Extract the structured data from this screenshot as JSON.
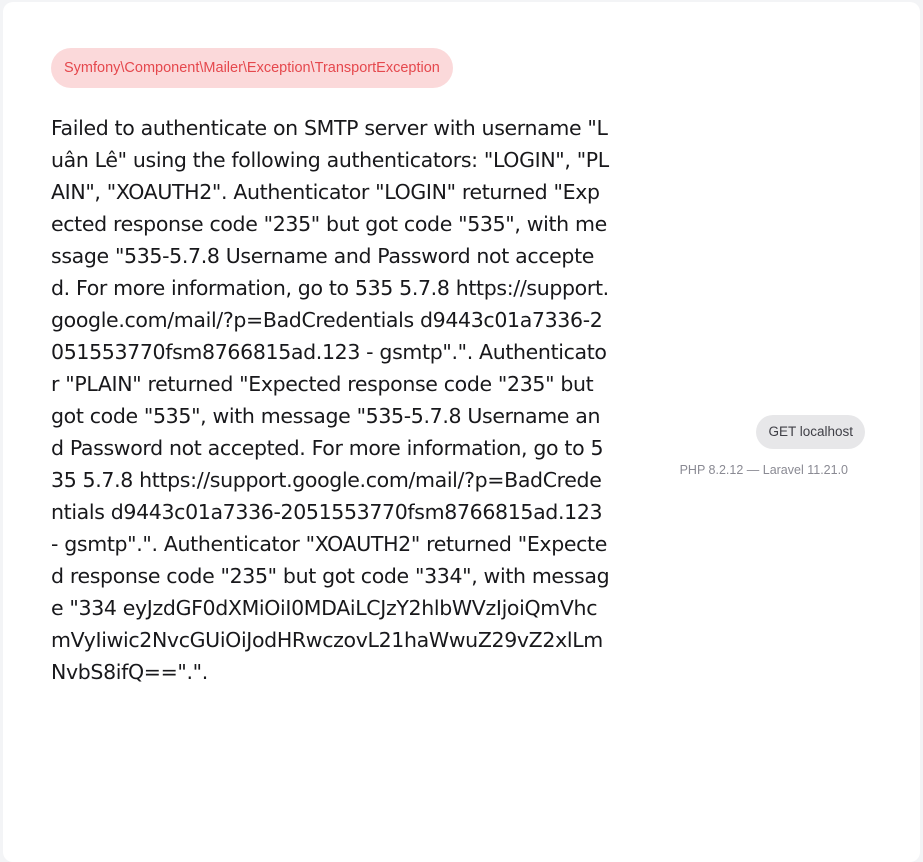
{
  "exception": {
    "class": "Symfony\\Component\\Mailer\\Exception\\TransportException",
    "message": "Failed to authenticate on SMTP server with username \"Luân Lê\" using the following authenticators: \"LOGIN\", \"PLAIN\", \"XOAUTH2\". Authenticator \"LOGIN\" returned \"Expected response code \"235\" but got code \"535\", with message \"535-5.7.8 Username and Password not accepted. For more information, go to 535 5.7.8 https://support.google.com/mail/?p=BadCredentials d9443c01a7336-2051553770fsm8766815ad.123 - gsmtp\".\". Authenticator \"PLAIN\" returned \"Expected response code \"235\" but got code \"535\", with message \"535-5.7.8 Username and Password not accepted. For more information, go to 535 5.7.8 https://support.google.com/mail/?p=BadCredentials d9443c01a7336-2051553770fsm8766815ad.123 - gsmtp\".\". Authenticator \"XOAUTH2\" returned \"Expected response code \"235\" but got code \"334\", with message \"334 eyJzdGF0dXMiOiI0MDAiLCJzY2hlbWVzIjoiQmVhcmVyIiwic2NvcGUiOiJodHRwczovL21haWwuZ29vZ2xlLmNvbS8ifQ==\".\"."
  },
  "request": {
    "label": "GET localhost"
  },
  "environment": {
    "versions": "PHP 8.2.12 — Laravel 11.21.0"
  },
  "colors": {
    "badge_bg": "#fbd9da",
    "badge_text": "#e5484d",
    "message_text": "#18181b",
    "pill_bg": "#e7e7e9",
    "muted_text": "#8a8a93"
  }
}
